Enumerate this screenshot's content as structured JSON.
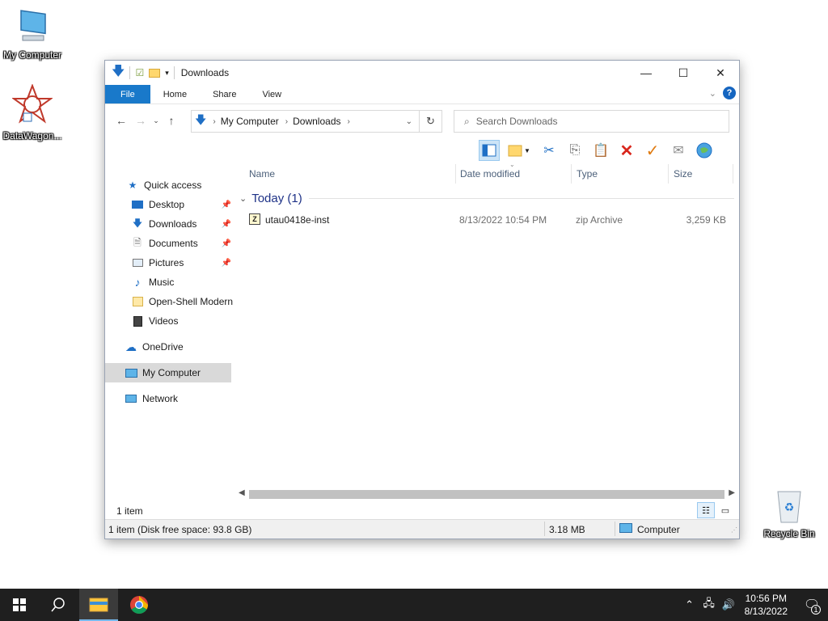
{
  "desktop": {
    "icons": [
      {
        "label": "My Computer"
      },
      {
        "label": "DataWagon..."
      },
      {
        "label": "Recycle Bin"
      }
    ]
  },
  "window": {
    "title": "Downloads",
    "controls": {
      "minimize": "—",
      "maximize": "☐",
      "close": "✕"
    },
    "ribbon_tabs": [
      "File",
      "Home",
      "Share",
      "View"
    ],
    "help": "?",
    "address": {
      "path": [
        "My Computer",
        "Downloads"
      ]
    },
    "search": {
      "placeholder": "Search Downloads"
    },
    "nav_pane": {
      "items": [
        {
          "label": "Quick access",
          "icon": "star-icon"
        },
        {
          "label": "Desktop",
          "icon": "desktop-icon",
          "pinned": true
        },
        {
          "label": "Downloads",
          "icon": "download-icon",
          "pinned": true
        },
        {
          "label": "Documents",
          "icon": "document-icon",
          "pinned": true
        },
        {
          "label": "Pictures",
          "icon": "picture-icon",
          "pinned": true
        },
        {
          "label": "Music",
          "icon": "music-icon"
        },
        {
          "label": "Open-Shell Modern",
          "icon": "folder-icon"
        },
        {
          "label": "Videos",
          "icon": "video-icon"
        },
        {
          "label": "OneDrive",
          "icon": "cloud-icon"
        },
        {
          "label": "My Computer",
          "icon": "computer-icon",
          "selected": true
        },
        {
          "label": "Network",
          "icon": "network-icon"
        }
      ]
    },
    "columns": [
      "Name",
      "Date modified",
      "Type",
      "Size"
    ],
    "group": {
      "label": "Today (1)"
    },
    "files": [
      {
        "name": "utau0418e-inst",
        "date": "8/13/2022 10:54 PM",
        "type": "zip Archive",
        "size": "3,259 KB"
      }
    ],
    "item_count": "1 item",
    "statusbar": {
      "disk": "1 item (Disk free space: 93.8 GB)",
      "size": "3.18 MB",
      "location": "Computer"
    }
  },
  "taskbar": {
    "time": "10:56 PM",
    "date": "8/13/2022",
    "notifications": "1"
  }
}
